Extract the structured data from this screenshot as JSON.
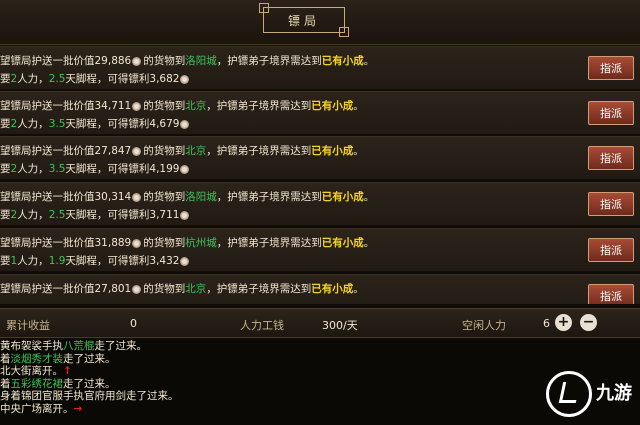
{
  "header": {
    "title": "镖局"
  },
  "orders": [
    {
      "prefix": "望镖局护送一批价值",
      "value": "29,886",
      "mid": "的货物到",
      "city": "洛阳城",
      "req": "，护镖弟子境界需达到",
      "rank": "已有小成",
      "end": "。",
      "l2a": "要",
      "people": "2",
      "l2b": "人力，",
      "days": "2.5",
      "l2c": "天脚程，可得镖利",
      "profit": "3,682",
      "button": "指派"
    },
    {
      "prefix": "望镖局护送一批价值",
      "value": "34,711",
      "mid": "的货物到",
      "city": "北京",
      "req": "，护镖弟子境界需达到",
      "rank": "已有小成",
      "end": "。",
      "l2a": "要",
      "people": "2",
      "l2b": "人力，",
      "days": "3.5",
      "l2c": "天脚程，可得镖利",
      "profit": "4,679",
      "button": "指派"
    },
    {
      "prefix": "望镖局护送一批价值",
      "value": "27,847",
      "mid": "的货物到",
      "city": "北京",
      "req": "，护镖弟子境界需达到",
      "rank": "已有小成",
      "end": "。",
      "l2a": "要",
      "people": "2",
      "l2b": "人力，",
      "days": "3.5",
      "l2c": "天脚程，可得镖利",
      "profit": "4,199",
      "button": "指派"
    },
    {
      "prefix": "望镖局护送一批价值",
      "value": "30,314",
      "mid": "的货物到",
      "city": "洛阳城",
      "req": "，护镖弟子境界需达到",
      "rank": "已有小成",
      "end": "。",
      "l2a": "要",
      "people": "2",
      "l2b": "人力，",
      "days": "2.5",
      "l2c": "天脚程，可得镖利",
      "profit": "3,711",
      "button": "指派"
    },
    {
      "prefix": "望镖局护送一批价值",
      "value": "31,889",
      "mid": "的货物到",
      "city": "杭州城",
      "req": "，护镖弟子境界需达到",
      "rank": "已有小成",
      "end": "。",
      "l2a": "要",
      "people": "1",
      "l2b": "人力，",
      "days": "1.9",
      "l2c": "天脚程，可得镖利",
      "profit": "3,432",
      "button": "指派"
    },
    {
      "prefix": "望镖局护送一批价值",
      "value": "27,801",
      "mid": "的货物到",
      "city": "北京",
      "req": "，护镖弟子境界需达到",
      "rank": "已有小成",
      "end": "。",
      "l2a": "",
      "people": "",
      "l2b": "",
      "days": "",
      "l2c": "",
      "profit": "",
      "button": "指派"
    }
  ],
  "status": {
    "income_label": "累计收益",
    "income_value": "0",
    "wage_label": "人力工钱",
    "wage_value": "300/天",
    "idle_label": "空闲人力",
    "idle_value": "6",
    "plus": "+",
    "minus": "−"
  },
  "log": [
    {
      "a": "黄布袈裟手执",
      "b": "八荒棍",
      "c": "走了过来。",
      "arrow": ""
    },
    {
      "a": "着",
      "b": "淡烟秀才装",
      "c": "走了过来。",
      "arrow": ""
    },
    {
      "a": "北大街离开。",
      "b": "",
      "c": "",
      "arrow": "↑"
    },
    {
      "a": "着",
      "b": "五彩绣花裙",
      "c": "走了过来。",
      "arrow": ""
    },
    {
      "a": "身着锦团官服手执官府用剑走了过来。",
      "b": "",
      "c": "",
      "arrow": ""
    },
    {
      "a": "中央广场离开。",
      "b": "",
      "c": "",
      "arrow": "→"
    }
  ],
  "watermark": {
    "text": "九游"
  },
  "colors": {
    "city": "#3ec25a",
    "rank": "#f5d421",
    "button": "#8c3a27"
  }
}
